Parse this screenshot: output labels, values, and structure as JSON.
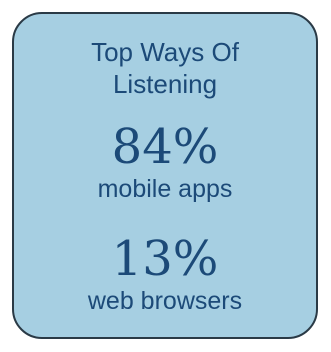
{
  "card": {
    "title_line1": "Top Ways Of",
    "title_line2": "Listening",
    "stats": [
      {
        "value": "84%",
        "label": "mobile apps"
      },
      {
        "value": "13%",
        "label": "web browsers"
      }
    ]
  },
  "colors": {
    "card_background": "#a6cfe2",
    "card_border": "#2a3a46",
    "text": "#1c4a78"
  }
}
